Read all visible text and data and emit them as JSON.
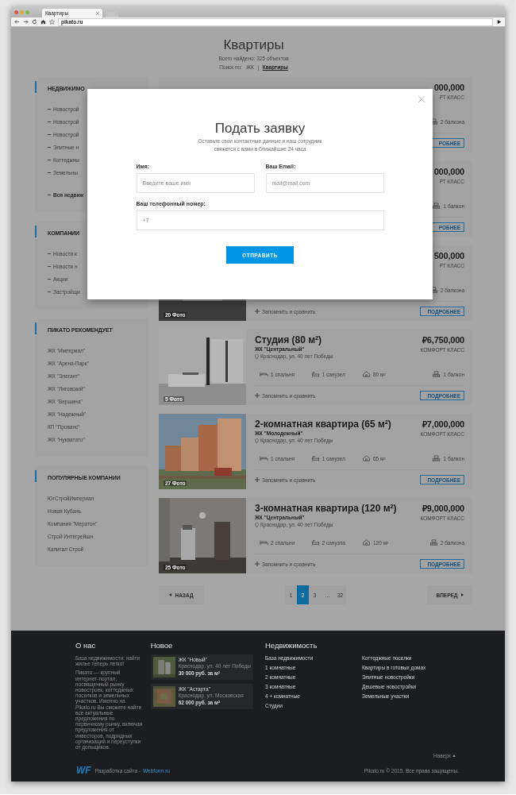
{
  "browser": {
    "tab_title": "Квартиры",
    "url": "pikato.ru"
  },
  "header": {
    "title": "Квартиры",
    "count": "Всего найдено: 325 объектов",
    "search_label": "Поиск по:",
    "search_options": [
      {
        "label": "ЖК",
        "selected": false
      },
      {
        "label": "Квартиры",
        "selected": true
      }
    ]
  },
  "sidebar": [
    {
      "heading": "НЕДВИЖИМО",
      "items": [
        {
          "label": "Новострой",
          "kind": "sub"
        },
        {
          "label": "Новострой",
          "kind": "sub"
        },
        {
          "label": "Новострой",
          "kind": "sub"
        },
        {
          "label": "Элитные н",
          "kind": "sub"
        },
        {
          "label": "Коттеджны",
          "kind": "sub"
        },
        {
          "label": "Земельны",
          "kind": "sub"
        },
        {
          "label": "Вся недвиж",
          "kind": "all"
        }
      ]
    },
    {
      "heading": "КОМПАНИИ",
      "items": [
        {
          "label": "Новости к",
          "kind": "sub"
        },
        {
          "label": "Новости н",
          "kind": "sub"
        },
        {
          "label": "Акции",
          "kind": "sub"
        },
        {
          "label": "Застройщи",
          "kind": "sub"
        }
      ]
    },
    {
      "heading": "ПИКАТО РЕКОМЕНДУЕТ",
      "items": [
        {
          "label": "ЖК \"Империал\"",
          "kind": "link"
        },
        {
          "label": "ЖК \"Арена-Парк\"",
          "kind": "link"
        },
        {
          "label": "ЖК \"Элегант\"",
          "kind": "link"
        },
        {
          "label": "ЖК \"Лиговский\"",
          "kind": "link"
        },
        {
          "label": "ЖК \"Вершина\"",
          "kind": "link"
        },
        {
          "label": "ЖК \"Надежный\"",
          "kind": "link"
        },
        {
          "label": "КП \"Прованс\"",
          "kind": "link"
        },
        {
          "label": "ЖК \"Нукватато\"",
          "kind": "link"
        }
      ]
    },
    {
      "heading": "ПОПУЛЯРНЫЕ КОМПАНИИ",
      "items": [
        {
          "label": "ЮгСтройИмпериал",
          "kind": "link"
        },
        {
          "label": "Новая Кубань",
          "kind": "link"
        },
        {
          "label": "Компания \"Мератон\"",
          "kind": "link"
        },
        {
          "label": "Строй Интегрейшн",
          "kind": "link"
        },
        {
          "label": "Капитал Строй",
          "kind": "link"
        }
      ]
    }
  ],
  "listings": [
    {
      "price": "000,000",
      "price_class": "РТ КЛАСС",
      "features": [
        {
          "kind": "balcony",
          "label": "2 балкона"
        }
      ],
      "details_button": "РОБНЕЕ"
    },
    {
      "price": "000,000",
      "price_class": "РТ КЛАСС",
      "features": [
        {
          "kind": "balcony",
          "label": "1 балкон"
        }
      ],
      "details_button": "РОБНЕЕ"
    },
    {
      "photo": {
        "kind": "picture"
      },
      "photo_count": "20 Фото",
      "price": "500,000",
      "price_class": "РТ КЛАСС",
      "features": [
        {
          "kind": "balcony",
          "label": "2 балкона"
        }
      ],
      "compare": "Запомнить и сравнить",
      "details_button": "ПОДРОБНЕЕ"
    },
    {
      "photo": {
        "kind": "picture"
      },
      "photo_count": "5 Фото",
      "title": "Студия (80 м²)",
      "complex": "ЖК \"Центральный\"",
      "address": "Краснодар, ул. 40 лет Победы",
      "price": "₽6,750,000",
      "price_class": "КОМФОРТ КЛАСС",
      "features": [
        {
          "kind": "bed",
          "label": "1 спальня"
        },
        {
          "kind": "bath",
          "label": "1 санузел"
        },
        {
          "kind": "area",
          "label": "80 м²"
        },
        {
          "kind": "balcony",
          "label": "1 балкон"
        }
      ],
      "compare": "Запомнить и сравнить",
      "details_button": "ПОДРОБНЕЕ"
    },
    {
      "photo": {
        "kind": "picture"
      },
      "photo_count": "27 Фото",
      "title": "2-комнатная квартира (65 м²)",
      "complex": "ЖК \"Молодежный\"",
      "address": "Краснодар, ул. 40 лет Победы",
      "price": "₽7,000,000",
      "price_class": "КОМФОРТ КЛАСС",
      "features": [
        {
          "kind": "bed",
          "label": "1 спальня"
        },
        {
          "kind": "bath",
          "label": "1 санузел"
        },
        {
          "kind": "area",
          "label": "65 м²"
        },
        {
          "kind": "balcony",
          "label": "1 балкон"
        }
      ],
      "compare": "Запомнить и сравнить",
      "details_button": "ПОДРОБНЕЕ"
    },
    {
      "photo": {
        "kind": "picture"
      },
      "photo_count": "25 Фото",
      "title": "3-комнатная квартира (120 м²)",
      "complex": "ЖК \"Центральный\"",
      "address": "Краснодар, ул. 40 лет Победы",
      "price": "₽9,000,000",
      "price_class": "КОМФОРТ КЛАСС",
      "features": [
        {
          "kind": "bed",
          "label": "2 спальни"
        },
        {
          "kind": "bath",
          "label": "2 санузла"
        },
        {
          "kind": "area",
          "label": "120 м²"
        },
        {
          "kind": "balcony",
          "label": "2 балкона"
        }
      ],
      "compare": "Запомнить и сравнить",
      "details_button": "ПОДРОБНЕЕ"
    }
  ],
  "pagination": {
    "prev": "НАЗАД",
    "next": "ВПЕРЕД",
    "pages": [
      {
        "label": "1",
        "kind": "page",
        "selected": false
      },
      {
        "label": "2",
        "kind": "page",
        "selected": true
      },
      {
        "label": "3",
        "kind": "page",
        "selected": false
      },
      {
        "label": "…",
        "kind": "gap"
      },
      {
        "label": "32",
        "kind": "page",
        "selected": false
      }
    ]
  },
  "modal": {
    "title": "Подать заявку",
    "subtitle": "Оставьте свои контактные данные и наш сотрудник свяжется с вами в ближайшие 24 часа",
    "name_label": "Имя:",
    "name_placeholder": "Введите ваше имя",
    "email_label": "Ваш Email:",
    "email_placeholder": "mail@mail.com",
    "phone_label": "Ваш телефонный номер:",
    "phone_placeholder": "+7",
    "submit": "ОТПРАВИТЬ"
  },
  "footer": {
    "about_heading": "О нас",
    "about_lead": "База недвижимости: найти жилье теперь легко!",
    "about_text": "Пикато — крупный интернет-портал, посвященный рынку новостроек, коттеджных поселков и земельных участков. Именно на Pikato.ru Вы сможете найти все актуальные предложения по первичному рынку, включая предложения от инвесторов, подрядных организаций и переуступки от дольщиков.",
    "new_heading": "Новое",
    "new_items": [
      {
        "photo": {
          "kind": "picture"
        },
        "name": "ЖК \"Новый\"",
        "address": "Краснодар, ул. 40 лет Победы",
        "price": "30 000 руб. за м²"
      },
      {
        "photo": {
          "kind": "picture"
        },
        "name": "ЖК \"Астарта\"",
        "address": "Краснодар, ул. Московская",
        "price": "62 000 руб. за м²"
      }
    ],
    "realty_heading": "Недвижимость",
    "realty_col1": [
      "База недвижимости",
      "1 комнатные",
      "2 комнатные",
      "3 комнатные",
      "4 + комнатные",
      "Студии"
    ],
    "realty_col2": [
      "Коттеджные поселки",
      "Квартиры в готовых домах",
      "Элитные новостройки",
      "Дешевые новостройки",
      "Земельные участки"
    ],
    "to_top": "Наверх",
    "logo": "WF",
    "dev_text": "Разработка сайта -",
    "dev_link": "Webform.ru",
    "copyright": "Pikato.ru © 2015. Все права защищены."
  }
}
